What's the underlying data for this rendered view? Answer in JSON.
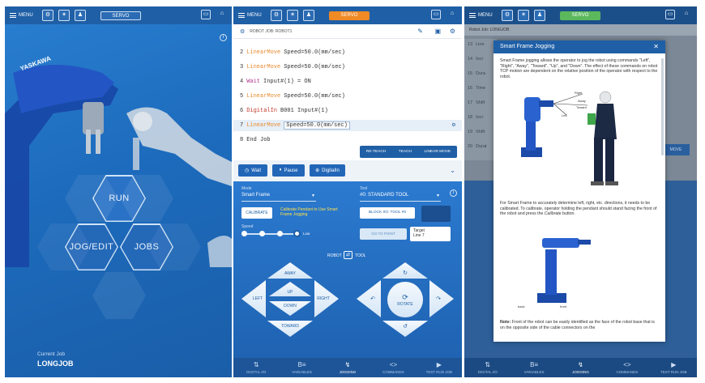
{
  "panel1": {
    "menu_label": "MENU",
    "servo_label": "SERVO",
    "brand": "YASKAWA",
    "hex": {
      "run": "RUN",
      "jog_edit": "JOG/EDIT",
      "jobs": "JOBS"
    },
    "current_job_label": "Current Job",
    "current_job_value": "LONGJOB"
  },
  "panel2": {
    "menu_label": "MENU",
    "servo_label": "SERVO",
    "job_header": "ROBOT JOB: ROBOT1",
    "code": [
      {
        "num": "2",
        "cmd": "LinearMove",
        "args": "Speed=50.0(mm/sec)",
        "kind": "o"
      },
      {
        "num": "3",
        "cmd": "LinearMove",
        "args": "Speed=50.0(mm/sec)",
        "kind": "o"
      },
      {
        "num": "4",
        "cmd": "Wait",
        "args": "Input#(1)  =  ON",
        "kind": "p"
      },
      {
        "num": "5",
        "cmd": "LinearMove",
        "args": "Speed=50.0(mm/sec)",
        "kind": "o"
      },
      {
        "num": "6",
        "cmd": "DigitalIn",
        "args": "B001 Input#(1)",
        "kind": "r"
      },
      {
        "num": "7",
        "cmd": "LinearMove",
        "args": "Speed=50.0(mm/sec)",
        "kind": "o"
      },
      {
        "num": "8",
        "cmd": "End Job",
        "args": "",
        "kind": "n"
      }
    ],
    "action_buttons": {
      "reteach": "RE-TEACH",
      "teach": "TEACH",
      "linear_move": "LINEAR MOVE"
    },
    "insert_buttons": {
      "wait": "Wait",
      "pause": "Pause",
      "digitalin": "DigitalIn"
    },
    "mode_label": "Mode",
    "mode_value": "Smart Frame",
    "tool_label": "Tool",
    "tool_value": "#0: STANDARD TOOL",
    "calibrate": "CALIBRATE",
    "calibrate_hint": "Calibrate Pendant to Use Smart Frame Jogging",
    "block_io": "BLOCK I/O: TOOL #0",
    "speed_label": "Speed",
    "speed_value_label": "Low",
    "go_to_point": "GO TO POINT",
    "target_label": "Target",
    "target_value": "Line 7",
    "robot_label": "ROBOT",
    "tool_toggle_label": "TOOL",
    "jog": {
      "away": "AWAY",
      "up": "UP",
      "down": "DOWN",
      "left": "LEFT",
      "right": "RIGHT",
      "toward": "TOWARD",
      "rotate": "ROTATE"
    },
    "tabs": [
      "DIGITAL I/O",
      "VARIABLES",
      "JOGGING",
      "COMMANDS",
      "TEST RUN JOB"
    ],
    "colors": {
      "servo_orange": "#f08a24",
      "servo_green": "#5cb85c",
      "accent": "#1f5fa6"
    }
  },
  "panel3": {
    "menu_label": "MENU",
    "servo_label": "SERVO",
    "job_header": "Robot Job: LONGJOB",
    "bg_line_numbers": [
      "13",
      "14",
      "15",
      "16",
      "17",
      "18",
      "19",
      "20"
    ],
    "bg_words": [
      "Line",
      "Incr",
      "Dura",
      "Time",
      "Shift",
      "Incr",
      "Shift",
      "Durat"
    ],
    "move_btn": "MOVE",
    "modal": {
      "title": "Smart Frame Jogging",
      "paragraph1": "Smart Frame jogging allows the operator to jog the robot using commands \"Left\", \"Right\", \"Away\", \"Toward\", \"Up\", and \"Down\". The effect of these commands on robot TCP motion are dependent on the relative position of the operator with respect to the robot.",
      "labels": {
        "right": "Right",
        "left": "Left",
        "toward": "Toward",
        "away": "Away"
      },
      "paragraph2_a": "For Smart Frame to accurately determine left, right, etc. directions, it needs to be calibrated. To calibrate, operator holding the pendant should stand facing the front of the robot and press the ",
      "paragraph2_em": "Calibrate",
      "paragraph2_b": " button.",
      "back_label": "back",
      "front_label": "front",
      "note_label": "Note:",
      "note_text": " Front of the robot can be easily identified as the face of the robot base that is on the opposite side of the cable connectors on the"
    },
    "tabs": [
      "DIGITAL I/O",
      "VARIABLES",
      "JOGGING",
      "COMMANDS",
      "TEST RUN JOB"
    ]
  }
}
